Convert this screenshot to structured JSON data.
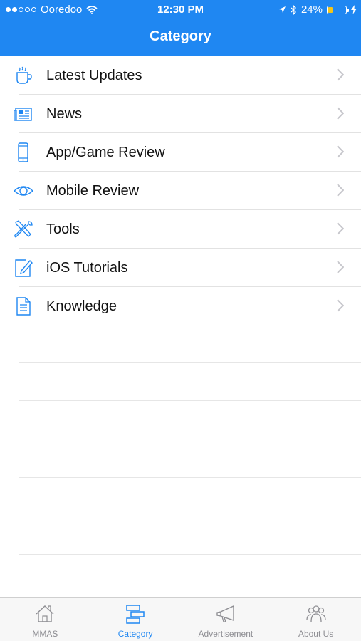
{
  "status_bar": {
    "carrier": "Ooredoo",
    "time": "12:30 PM",
    "battery": "24%",
    "battery_level": 0.24
  },
  "nav": {
    "title": "Category"
  },
  "categories": [
    {
      "label": "Latest Updates",
      "icon": "coffee-cup-icon"
    },
    {
      "label": "News",
      "icon": "newspaper-icon"
    },
    {
      "label": "App/Game Review",
      "icon": "phone-icon"
    },
    {
      "label": "Mobile Review",
      "icon": "eye-icon"
    },
    {
      "label": "Tools",
      "icon": "tools-icon"
    },
    {
      "label": "iOS Tutorials",
      "icon": "edit-note-icon"
    },
    {
      "label": "Knowledge",
      "icon": "document-icon"
    }
  ],
  "tabs": [
    {
      "label": "MMAS",
      "icon": "home-icon",
      "active": false
    },
    {
      "label": "Category",
      "icon": "category-icon",
      "active": true
    },
    {
      "label": "Advertisement",
      "icon": "megaphone-icon",
      "active": false
    },
    {
      "label": "About Us",
      "icon": "people-icon",
      "active": false
    }
  ],
  "colors": {
    "accent": "#1f87f2",
    "tab_inactive": "#8e8e93",
    "battery_fill": "#f5c518"
  }
}
